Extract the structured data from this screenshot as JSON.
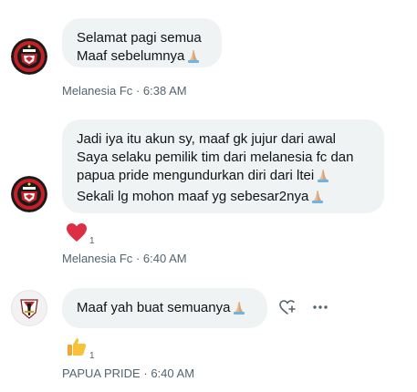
{
  "messages": [
    {
      "lines": [
        [
          {
            "text": "Selamat pagi semua"
          }
        ],
        [
          {
            "text": "Maaf sebelumnya"
          },
          {
            "emoji": "folded-hands"
          }
        ]
      ],
      "sender": "Melanesia Fc",
      "separator": "·",
      "time": "6:38 AM"
    },
    {
      "lines": [
        [
          {
            "text": "Jadi iya itu akun sy, maaf gk jujur dari awal"
          }
        ],
        [
          {
            "text": "Saya selaku pemilik tim dari melanesia fc dan"
          }
        ],
        [
          {
            "text": "papua pride mengundurkan diri dari ltei"
          },
          {
            "emoji": "folded-hands"
          }
        ],
        [
          {
            "text": "Sekali lg mohon maaf yg sebesar2nya"
          },
          {
            "emoji": "folded-hands"
          }
        ]
      ],
      "reaction": {
        "emoji": "red-heart",
        "count": "1"
      },
      "sender": "Melanesia Fc",
      "separator": "·",
      "time": "6:40 AM"
    },
    {
      "lines": [
        [
          {
            "text": "Maaf yah buat semuanya"
          },
          {
            "emoji": "folded-hands"
          }
        ]
      ],
      "reaction": {
        "emoji": "thumbs-up",
        "count": "1"
      },
      "sender": "PAPUA PRIDE",
      "separator": "·",
      "time": "6:40 AM"
    }
  ],
  "colors": {
    "bubble": "#eff3f4",
    "meta_text": "#536471",
    "text": "#0f1419",
    "heart": "#dd2e44",
    "skin": "#e8b98f",
    "thumb": "#f7c23a"
  },
  "icons": {
    "react": "add-reaction-icon",
    "more": "more-icon"
  }
}
